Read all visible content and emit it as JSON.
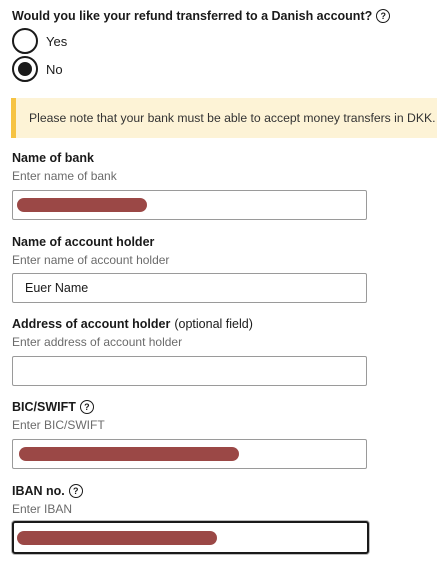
{
  "question": {
    "text": "Would you like your refund transferred to a Danish account?"
  },
  "radios": {
    "yes": {
      "label": "Yes",
      "selected": false
    },
    "no": {
      "label": "No",
      "selected": true
    }
  },
  "notice": {
    "text": "Please note that your bank must be able to accept money transfers in DKK."
  },
  "fields": {
    "bank_name": {
      "label": "Name of bank",
      "hint": "Enter name of bank",
      "value": ""
    },
    "account_holder": {
      "label": "Name of account holder",
      "hint": "Enter name of account holder",
      "value": "Euer Name"
    },
    "address": {
      "label": "Address of account holder",
      "optional": "(optional field)",
      "hint": "Enter address of account holder",
      "value": ""
    },
    "bic": {
      "label": "BIC/SWIFT",
      "hint": "Enter BIC/SWIFT",
      "value": ""
    },
    "iban": {
      "label": "IBAN no.",
      "hint": "Enter IBAN",
      "value": ""
    }
  },
  "icons": {
    "help": "question-circle-icon",
    "help_glyph": "?"
  },
  "colors": {
    "notice_bg": "#fdf3d6",
    "notice_border": "#f6c343",
    "redaction": "#9b4846"
  }
}
